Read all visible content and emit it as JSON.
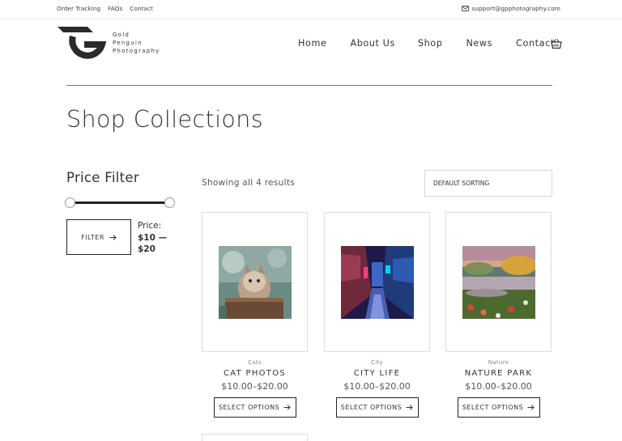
{
  "topbar": {
    "links": [
      "Order Tracking",
      "FAQs",
      "Contact"
    ],
    "email": "support@gpphotography.com"
  },
  "brand": {
    "lines": [
      "Gold",
      "Penguin",
      "Photography"
    ]
  },
  "nav": {
    "items": [
      "Home",
      "About Us",
      "Shop",
      "News",
      "Contact"
    ]
  },
  "page": {
    "title": "Shop Collections"
  },
  "filter": {
    "title": "Price Filter",
    "button_label": "FILTER",
    "price_label": "Price:",
    "price_range": "$10 — $20",
    "range": {
      "min": 10,
      "max": 20
    }
  },
  "results": {
    "text": "Showing all 4 results"
  },
  "sorting": {
    "selected": "DEFAULT SORTING"
  },
  "products": [
    {
      "category": "Cats",
      "name": "CAT PHOTOS",
      "price": "$10.00–$20.00",
      "button": "SELECT OPTIONS"
    },
    {
      "category": "City",
      "name": "CITY LIFE",
      "price": "$10.00–$20.00",
      "button": "SELECT OPTIONS"
    },
    {
      "category": "Nature",
      "name": "NATURE PARK",
      "price": "$10.00–$20.00",
      "button": "SELECT OPTIONS"
    }
  ],
  "icons": {
    "email": "envelope-icon",
    "cart": "basket-icon",
    "arrow": "arrow-right-icon"
  }
}
